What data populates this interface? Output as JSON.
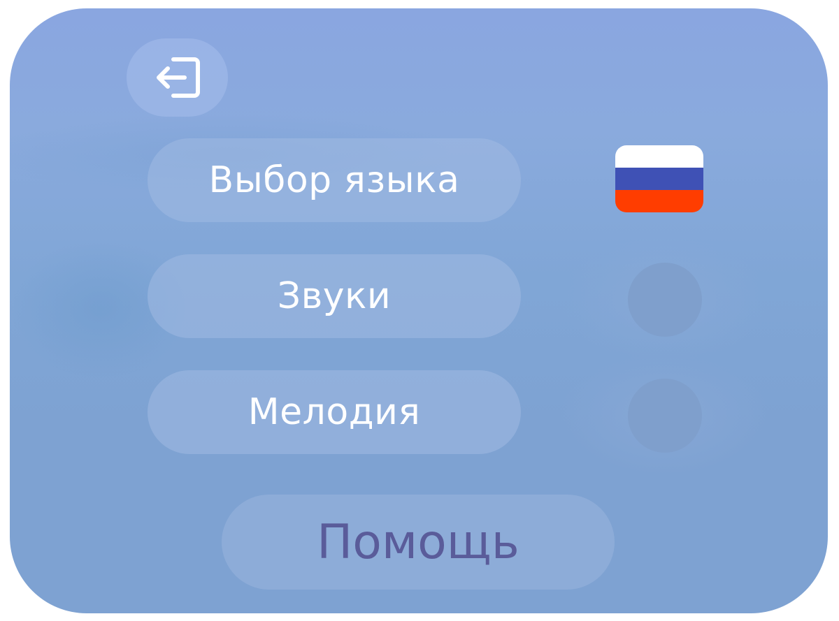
{
  "menu": {
    "exit_icon": "exit-icon",
    "language_label": "Выбор языка",
    "sounds_label": "Звуки",
    "melody_label": "Мелодия",
    "help_label": "Помощь"
  },
  "language": {
    "flag": "russian-flag-icon",
    "flag_colors": [
      "#ffffff",
      "#3f51b5",
      "#ff3d00"
    ]
  },
  "toggles": {
    "sounds_on": false,
    "melody_on": false
  },
  "colors": {
    "panel": "#8aa6e0",
    "button_text": "#ffffff",
    "help_text": "#5a5c9a"
  }
}
